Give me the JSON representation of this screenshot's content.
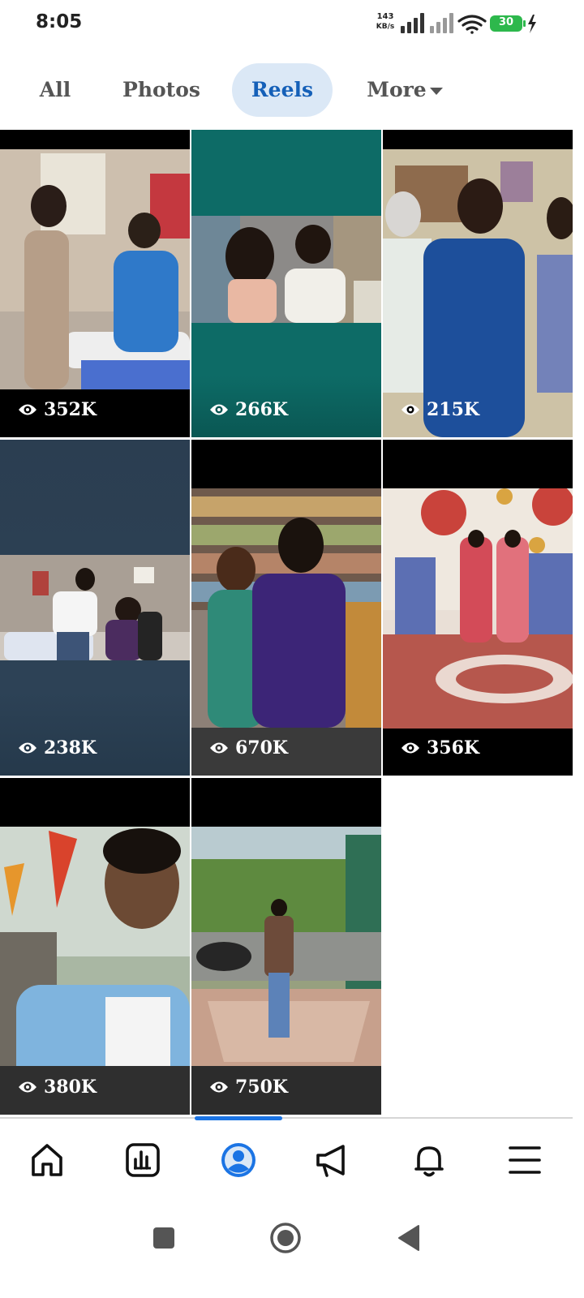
{
  "status_bar": {
    "time": "8:05",
    "net_speed_value": "143",
    "net_speed_unit": "KB/s",
    "battery": "30",
    "icons": [
      "signal-icon",
      "signal-icon",
      "wifi-icon",
      "battery-icon",
      "charging-icon"
    ]
  },
  "tabs": {
    "all": "All",
    "photos": "Photos",
    "reels": "Reels",
    "more": "More",
    "selected": "Reels",
    "accent_color": "#1560b8"
  },
  "reels": [
    {
      "views": "352K",
      "icon": "eye-icon"
    },
    {
      "views": "266K",
      "icon": "eye-icon"
    },
    {
      "views": "215K",
      "icon": "eye-icon"
    },
    {
      "views": "238K",
      "icon": "eye-icon"
    },
    {
      "views": "670K",
      "icon": "eye-icon"
    },
    {
      "views": "356K",
      "icon": "eye-icon"
    },
    {
      "views": "380K",
      "icon": "eye-icon"
    },
    {
      "views": "750K",
      "icon": "eye-icon"
    }
  ],
  "bottom_nav": {
    "items": [
      "home-icon",
      "insights-icon",
      "profile-icon",
      "megaphone-icon",
      "bell-icon",
      "menu-icon"
    ],
    "active": "profile-icon",
    "active_color": "#1b74e4"
  },
  "system_nav": [
    "recents-button",
    "home-button",
    "back-button"
  ]
}
